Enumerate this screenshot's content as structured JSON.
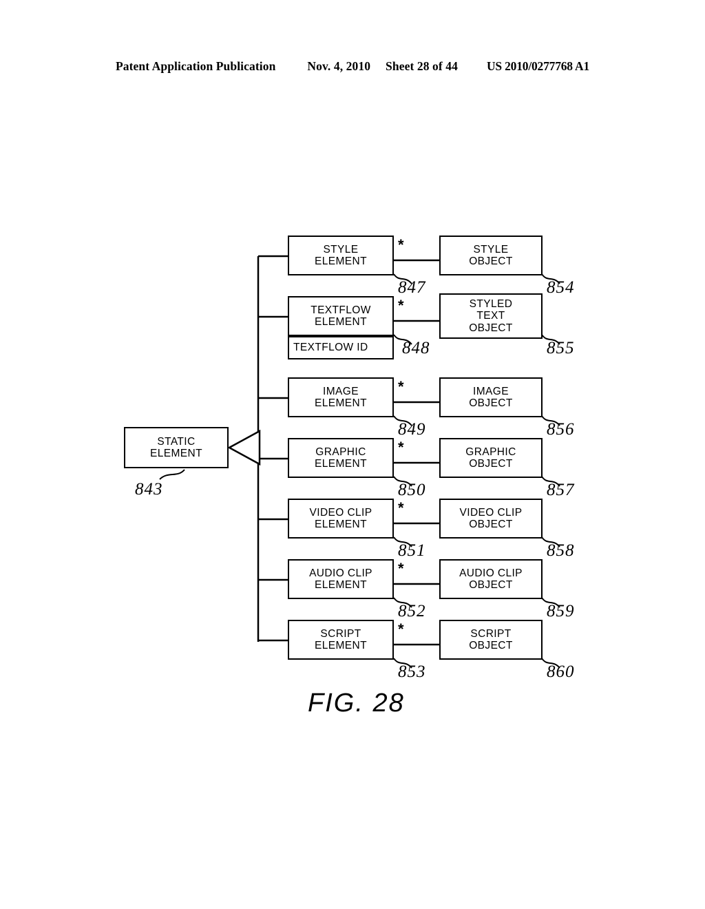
{
  "header": {
    "publication": "Patent Application Publication",
    "date": "Nov. 4, 2010",
    "sheet": "Sheet 28 of 44",
    "patent_number": "US 2010/0277768 A1"
  },
  "figure": {
    "caption": "FIG. 28",
    "multiplicity_symbol": "*"
  },
  "diagram": {
    "base_class": {
      "label_lines": [
        "STATIC",
        "ELEMENT"
      ],
      "ref": "843"
    },
    "rows": [
      {
        "element": {
          "label_lines": [
            "STYLE",
            "ELEMENT"
          ],
          "ref": "847"
        },
        "object": {
          "label_lines": [
            "STYLE",
            "OBJECT"
          ],
          "ref": "854"
        }
      },
      {
        "element": {
          "label_lines": [
            "TEXTFLOW",
            "ELEMENT"
          ],
          "attribute": "TEXTFLOW ID",
          "ref": "848"
        },
        "object": {
          "label_lines": [
            "STYLED",
            "TEXT",
            "OBJECT"
          ],
          "ref": "855"
        }
      },
      {
        "element": {
          "label_lines": [
            "IMAGE",
            "ELEMENT"
          ],
          "ref": "849"
        },
        "object": {
          "label_lines": [
            "IMAGE",
            "OBJECT"
          ],
          "ref": "856"
        }
      },
      {
        "element": {
          "label_lines": [
            "GRAPHIC",
            "ELEMENT"
          ],
          "ref": "850"
        },
        "object": {
          "label_lines": [
            "GRAPHIC",
            "OBJECT"
          ],
          "ref": "857"
        }
      },
      {
        "element": {
          "label_lines": [
            "VIDEO CLIP",
            "ELEMENT"
          ],
          "ref": "851"
        },
        "object": {
          "label_lines": [
            "VIDEO CLIP",
            "OBJECT"
          ],
          "ref": "858"
        }
      },
      {
        "element": {
          "label_lines": [
            "AUDIO CLIP",
            "ELEMENT"
          ],
          "ref": "852"
        },
        "object": {
          "label_lines": [
            "AUDIO CLIP",
            "OBJECT"
          ],
          "ref": "859"
        }
      },
      {
        "element": {
          "label_lines": [
            "SCRIPT",
            "ELEMENT"
          ],
          "ref": "853"
        },
        "object": {
          "label_lines": [
            "SCRIPT",
            "OBJECT"
          ],
          "ref": "860"
        }
      }
    ]
  },
  "colors": {
    "ink": "#000000",
    "paper": "#ffffff"
  }
}
